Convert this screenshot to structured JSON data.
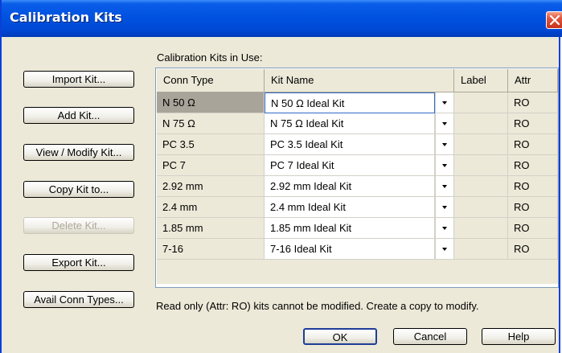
{
  "window": {
    "title": "Calibration Kits"
  },
  "side_buttons": [
    {
      "label": "Import Kit...",
      "enabled": true
    },
    {
      "label": "Add Kit...",
      "enabled": true
    },
    {
      "label": "View / Modify Kit...",
      "enabled": true
    },
    {
      "label": "Copy Kit to...",
      "enabled": true
    },
    {
      "label": "Delete Kit...",
      "enabled": false
    },
    {
      "label": "Export Kit...",
      "enabled": true
    },
    {
      "label": "Avail Conn Types...",
      "enabled": true
    }
  ],
  "grid": {
    "caption": "Calibration Kits in Use:",
    "headers": {
      "conn_type": "Conn Type",
      "kit_name": "Kit Name",
      "label": "Label",
      "attr": "Attr"
    },
    "rows": [
      {
        "conn": "N 50 Ω",
        "kit": "N 50 Ω Ideal Kit",
        "label": "",
        "attr": "RO"
      },
      {
        "conn": "N 75 Ω",
        "kit": "N 75 Ω Ideal Kit",
        "label": "",
        "attr": "RO"
      },
      {
        "conn": "PC 3.5",
        "kit": "PC 3.5 Ideal Kit",
        "label": "",
        "attr": "RO"
      },
      {
        "conn": "PC 7",
        "kit": "PC 7 Ideal Kit",
        "label": "",
        "attr": "RO"
      },
      {
        "conn": "2.92 mm",
        "kit": "2.92 mm Ideal Kit",
        "label": "",
        "attr": "RO"
      },
      {
        "conn": "2.4 mm",
        "kit": "2.4 mm Ideal Kit",
        "label": "",
        "attr": "RO"
      },
      {
        "conn": "1.85 mm",
        "kit": "1.85 mm Ideal Kit",
        "label": "",
        "attr": "RO"
      },
      {
        "conn": "7-16",
        "kit": "7-16 Ideal Kit",
        "label": "",
        "attr": "RO"
      }
    ]
  },
  "note": "Read only (Attr: RO)  kits cannot be modified. Create a copy to modify.",
  "footer": {
    "ok": "OK",
    "cancel": "Cancel",
    "help": "Help"
  }
}
